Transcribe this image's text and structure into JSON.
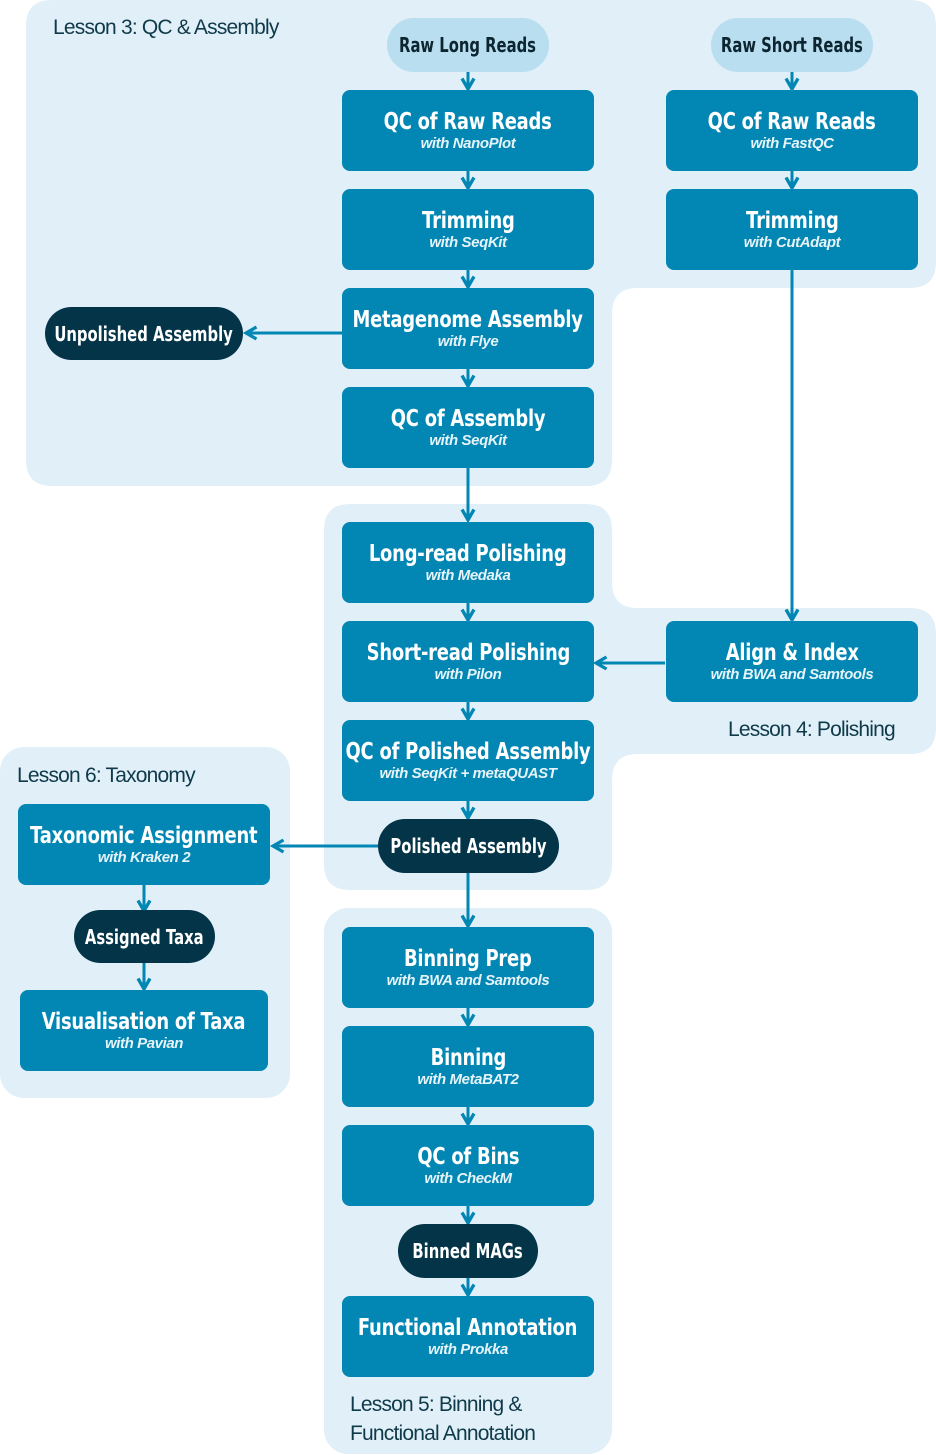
{
  "lessons": {
    "l3": "Lesson 3: QC & Assembly",
    "l4": "Lesson 4: Polishing",
    "l5_line1": "Lesson 5: Binning &",
    "l5_line2": "Functional Annotation",
    "l6": "Lesson 6: Taxonomy"
  },
  "inputs": {
    "long": "Raw Long Reads",
    "short": "Raw Short Reads"
  },
  "steps": {
    "qc_long": {
      "title": "QC of Raw Reads",
      "tool": "with NanoPlot"
    },
    "trim_long": {
      "title": "Trimming",
      "tool": "with SeqKit"
    },
    "assembly": {
      "title": "Metagenome Assembly",
      "tool": "with Flye"
    },
    "qc_assembly": {
      "title": "QC of Assembly",
      "tool": "with SeqKit"
    },
    "qc_short": {
      "title": "QC of Raw Reads",
      "tool": "with FastQC"
    },
    "trim_short": {
      "title": "Trimming",
      "tool": "with CutAdapt"
    },
    "lr_polish": {
      "title": "Long-read Polishing",
      "tool": "with Medaka"
    },
    "sr_polish": {
      "title": "Short-read Polishing",
      "tool": "with Pilon"
    },
    "align": {
      "title": "Align & Index",
      "tool": "with BWA and Samtools"
    },
    "qc_polished": {
      "title": "QC of Polished Assembly",
      "tool": "with SeqKit + metaQUAST"
    },
    "tax_assign": {
      "title": "Taxonomic Assignment",
      "tool": "with Kraken 2"
    },
    "tax_vis": {
      "title": "Visualisation of Taxa",
      "tool": "with Pavian"
    },
    "bin_prep": {
      "title": "Binning Prep",
      "tool": "with BWA and Samtools"
    },
    "binning": {
      "title": "Binning",
      "tool": "with MetaBAT2"
    },
    "qc_bins": {
      "title": "QC of Bins",
      "tool": "with CheckM"
    },
    "func_annot": {
      "title": "Functional Annotation",
      "tool": "with Prokka"
    }
  },
  "outputs": {
    "unpolished": "Unpolished Assembly",
    "polished": "Polished Assembly",
    "taxa": "Assigned Taxa",
    "mags": "Binned MAGs"
  },
  "colors": {
    "region": "#e1f0f8",
    "step": "#0286b3",
    "input": "#b9def0",
    "output": "#033447",
    "edge": "#0286b3"
  }
}
